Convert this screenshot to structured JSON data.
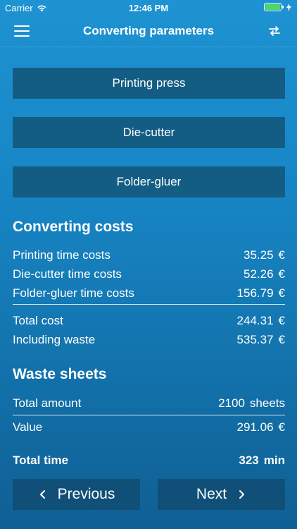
{
  "status_bar": {
    "carrier": "Carrier",
    "time": "12:46 PM"
  },
  "nav": {
    "title": "Converting parameters"
  },
  "machines": [
    {
      "label": "Printing press"
    },
    {
      "label": "Die-cutter"
    },
    {
      "label": "Folder-gluer"
    }
  ],
  "converting_costs": {
    "title": "Converting costs",
    "rows": [
      {
        "label": "Printing time costs",
        "value": "35.25",
        "unit": "€"
      },
      {
        "label": "Die-cutter time costs",
        "value": "52.26",
        "unit": "€"
      },
      {
        "label": "Folder-gluer time costs",
        "value": "156.79",
        "unit": "€"
      }
    ],
    "total": {
      "label": "Total cost",
      "value": "244.31",
      "unit": "€"
    },
    "including_waste": {
      "label": "Including waste",
      "value": "535.37",
      "unit": "€"
    }
  },
  "waste_sheets": {
    "title": "Waste sheets",
    "total_amount": {
      "label": "Total amount",
      "value": "2100",
      "unit": "sheets"
    },
    "value": {
      "label": "Value",
      "value": "291.06",
      "unit": "€"
    }
  },
  "total_time": {
    "label": "Total time",
    "value": "323",
    "unit": "min"
  },
  "footer": {
    "previous_label": "Previous",
    "next_label": "Next"
  },
  "colors": {
    "battery": "#4cd964",
    "button": "#135d85",
    "footer_button": "#104f78"
  }
}
